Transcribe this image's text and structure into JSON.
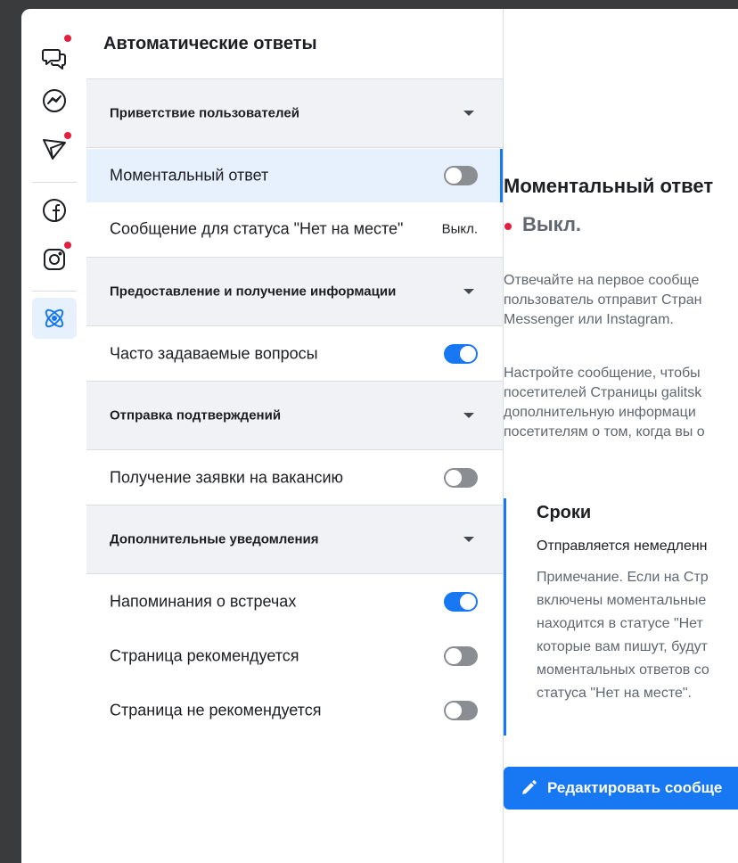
{
  "list": {
    "title": "Автоматические ответы",
    "sections": [
      {
        "label": "Приветствие пользователей",
        "rows": [
          {
            "label": "Моментальный ответ",
            "control": "toggle",
            "on": false,
            "selected": true
          },
          {
            "label": "Сообщение для статуса \"Нет на месте\"",
            "control": "status",
            "status": "Выкл."
          }
        ]
      },
      {
        "label": "Предоставление и получение информации",
        "rows": [
          {
            "label": "Часто задаваемые вопросы",
            "control": "toggle",
            "on": true
          }
        ]
      },
      {
        "label": "Отправка подтверждений",
        "rows": [
          {
            "label": "Получение заявки на вакансию",
            "control": "toggle",
            "on": false
          }
        ]
      },
      {
        "label": "Дополнительные уведомления",
        "rows": [
          {
            "label": "Напоминания о встречах",
            "control": "toggle",
            "on": true
          },
          {
            "label": "Страница рекомендуется",
            "control": "toggle",
            "on": false
          },
          {
            "label": "Страница не рекомендуется",
            "control": "toggle",
            "on": false
          }
        ]
      }
    ]
  },
  "rail": {
    "icons": [
      "chat-bubbles-icon",
      "messenger-icon",
      "send-icon",
      "facebook-icon",
      "instagram-icon",
      "atom-icon"
    ]
  },
  "detail": {
    "title": "Моментальный ответ",
    "status": "Выкл.",
    "paragraph1": [
      "Отвечайте на первое сообще",
      "пользователь отправит Стран",
      "Messenger или Instagram."
    ],
    "paragraph2": [
      "Настройте сообщение, чтобы",
      "посетителей Страницы galitsk",
      "дополнительную информаци",
      "посетителям о том, когда вы о"
    ],
    "timing": {
      "title": "Сроки",
      "value": "Отправляется немедленн",
      "note": [
        "Примечание. Если на Стр",
        "включены моментальные",
        "находится в статусе \"Нет",
        "которые вам пишут, будут",
        "моментальных ответов со",
        "статуса \"Нет на месте\"."
      ]
    },
    "edit_button": "Редактировать сообще"
  },
  "colors": {
    "accent": "#1877f2",
    "notification": "#e41e3f",
    "selected_bg": "#e7f0fd",
    "section_bg": "#f0f2f5"
  }
}
